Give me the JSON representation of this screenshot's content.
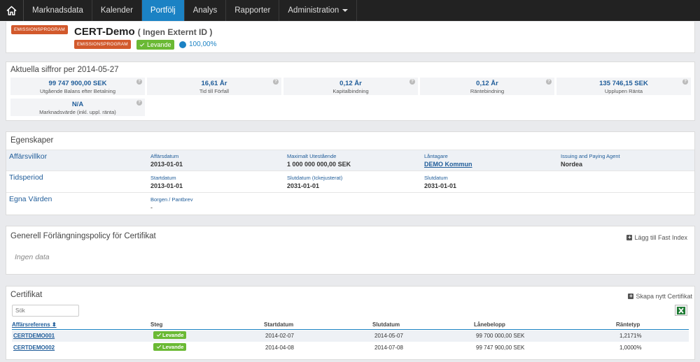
{
  "nav": {
    "items": [
      "Marknadsdata",
      "Kalender",
      "Portfölj",
      "Analys",
      "Rapporter",
      "Administration"
    ],
    "active": "Portfölj"
  },
  "header": {
    "program_badge_top": "EMISSIONSPROGRAM",
    "program_badge": "EMISSIONSPROGRAM",
    "title": "CERT-Demo",
    "subtitle": "( Ingen Externt ID )",
    "status": "Levande",
    "percent": "100,00%"
  },
  "figures": {
    "title": "Aktuella siffror per 2014-05-27",
    "items": [
      {
        "value": "99 747 900,00 SEK",
        "label": "Utgående Balans efter Betalning"
      },
      {
        "value": "16,61 År",
        "label": "Tid till Förfall"
      },
      {
        "value": "0,12 År",
        "label": "Kapitalbindning"
      },
      {
        "value": "0,12 År",
        "label": "Räntebindning"
      },
      {
        "value": "135 746,15 SEK",
        "label": "Upplupen Ränta"
      },
      {
        "value": "N/A",
        "label": "Marknadsvärde (inkl. uppl. ränta)"
      }
    ]
  },
  "properties": {
    "title": "Egenskaper",
    "rows": [
      {
        "label": "Affärsvillkor",
        "cells": [
          {
            "key": "Affärsdatum",
            "value": "2013-01-01"
          },
          {
            "key": "Maximalt Utestående",
            "value": "1 000 000 000,00 SEK"
          },
          {
            "key": "Låntagare",
            "value": "DEMO Kommun"
          },
          {
            "key": "Issuing and Paying Agent",
            "value": "Nordea"
          }
        ]
      },
      {
        "label": "Tidsperiod",
        "cells": [
          {
            "key": "Startdatum",
            "value": "2013-01-01"
          },
          {
            "key": "Slutdatum (Ickejusterat)",
            "value": "2031-01-01"
          },
          {
            "key": "Slutdatum",
            "value": "2031-01-01"
          }
        ]
      },
      {
        "label": "Egna Värden",
        "cells": [
          {
            "key": "Borgen / Pantbrev",
            "value": "-"
          }
        ]
      }
    ]
  },
  "policy": {
    "title": "Generell Förlängningspolicy för Certifikat",
    "action": "Lägg till Fast Index",
    "empty": "Ingen data"
  },
  "certificates": {
    "title": "Certifikat",
    "action": "Skapa nytt Certifikat",
    "search_placeholder": "Sök",
    "columns": [
      "Affärsreferens",
      "Steg",
      "Startdatum",
      "Slutdatum",
      "Lånebelopp",
      "Räntetyp"
    ],
    "rows": [
      {
        "ref": "CERTDEMO001",
        "status": "Levande",
        "start": "2014-02-07",
        "end": "2014-05-07",
        "amount": "99 700 000,00 SEK",
        "rate": "1,2171%"
      },
      {
        "ref": "CERTDEMO002",
        "status": "Levande",
        "start": "2014-04-08",
        "end": "2014-07-08",
        "amount": "99 747 900,00 SEK",
        "rate": "1,0000%"
      }
    ]
  },
  "colors": {
    "nav_bg": "#222222",
    "nav_active": "#1b82c4",
    "badge_orange": "#d2592c",
    "badge_green": "#6ab934",
    "link": "#1f5c99"
  }
}
